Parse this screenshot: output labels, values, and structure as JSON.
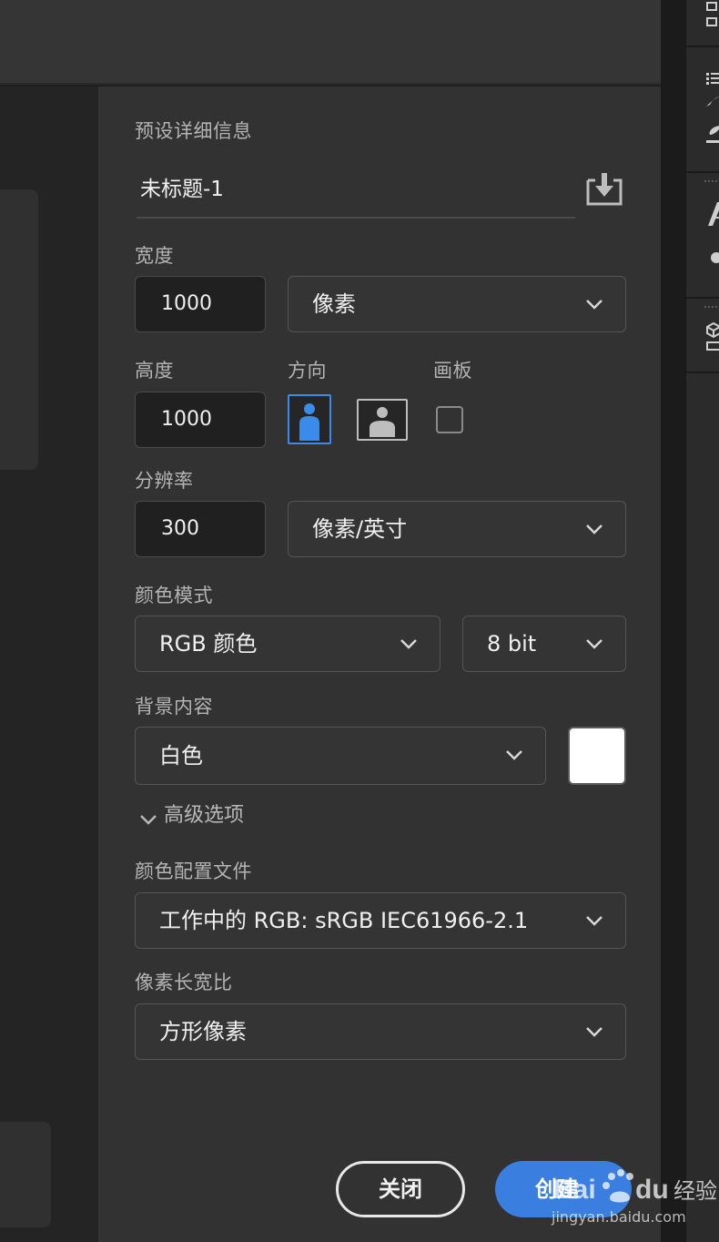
{
  "colors": {
    "accent": "#3a7fe0",
    "panel_bg": "#323232",
    "field_bg": "#202020",
    "selected_orientation": "#3b8bea",
    "background_swatch": "#ffffff"
  },
  "preset_details": {
    "section_label": "预设详细信息",
    "document_title": "未标题-1",
    "save_preset_icon": "save-preset-icon"
  },
  "width": {
    "label": "宽度",
    "value": "1000",
    "unit": "像素"
  },
  "height": {
    "label": "高度",
    "value": "1000"
  },
  "orientation": {
    "label": "方向",
    "selected": "portrait"
  },
  "artboard": {
    "label": "画板",
    "checked": false
  },
  "resolution": {
    "label": "分辨率",
    "value": "300",
    "unit": "像素/英寸"
  },
  "color_mode": {
    "label": "颜色模式",
    "mode": "RGB 颜色",
    "depth": "8 bit"
  },
  "background": {
    "label": "背景内容",
    "value": "白色"
  },
  "advanced": {
    "label": "高级选项"
  },
  "color_profile": {
    "label": "颜色配置文件",
    "value": "工作中的 RGB: sRGB IEC61966-2.1"
  },
  "pixel_aspect": {
    "label": "像素长宽比",
    "value": "方形像素"
  },
  "buttons": {
    "close": "关闭",
    "create": "创建"
  },
  "watermark": {
    "brand": "Baidu经验",
    "url": "jingyan.baidu.com"
  }
}
